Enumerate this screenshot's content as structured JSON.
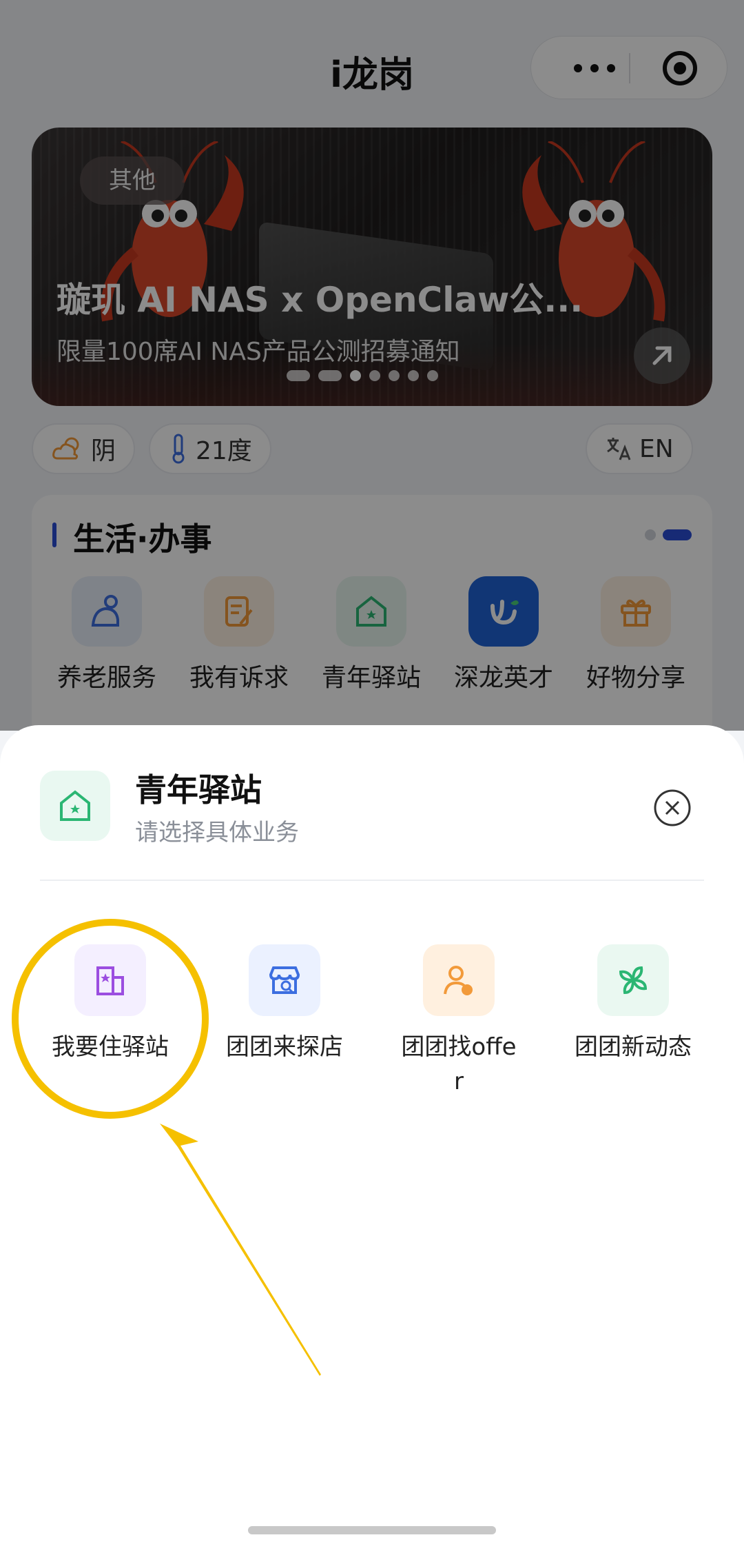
{
  "app": {
    "title": "i龙岗"
  },
  "capsule": {
    "more_icon": "more-dots-icon",
    "close_icon": "target-circle-icon"
  },
  "banner": {
    "tag": "其他",
    "title": "璇玑 AI NAS x OpenClaw公...",
    "subtitle": "限量100席AI NAS产品公测招募通知",
    "arrow_icon": "arrow-up-right-icon",
    "slides": 7,
    "active_slide": 3
  },
  "weather": {
    "condition": "阴",
    "condition_icon": "cloud-sun-icon",
    "temperature": "21度",
    "temperature_icon": "thermometer-icon",
    "language": "EN",
    "language_icon": "translate-icon"
  },
  "life_section": {
    "title": "生活·办事",
    "pages": 2,
    "active_page": 2,
    "services": [
      {
        "label": "养老服务",
        "icon": "elder-care-icon",
        "color": "#e8eef9"
      },
      {
        "label": "我有诉求",
        "icon": "edit-document-icon",
        "color": "#fdf0e2"
      },
      {
        "label": "青年驿站",
        "icon": "youth-house-icon",
        "color": "#e8f6ef"
      },
      {
        "label": "深龙英才",
        "icon": "talent-logo-icon",
        "color": "#1f63d6"
      },
      {
        "label": "好物分享",
        "icon": "gift-icon",
        "color": "#fdf0e2"
      }
    ]
  },
  "sheet": {
    "title": "青年驿站",
    "subtitle": "请选择具体业务",
    "icon": "youth-house-icon",
    "close_icon": "close-circle-icon",
    "items": [
      {
        "label": "我要住驿站",
        "icon": "building-star-icon",
        "color": "#f4efff"
      },
      {
        "label": "团团来探店",
        "icon": "shop-search-icon",
        "color": "#ebf1ff"
      },
      {
        "label": "团团找offer",
        "icon": "person-badge-icon",
        "color": "#fff0df"
      },
      {
        "label": "团团新动态",
        "icon": "pinwheel-icon",
        "color": "#eaf8f1"
      }
    ]
  },
  "colors": {
    "accent": "#2a4ed6",
    "highlight": "#f5c000",
    "sheet_green": "#2bb673"
  }
}
